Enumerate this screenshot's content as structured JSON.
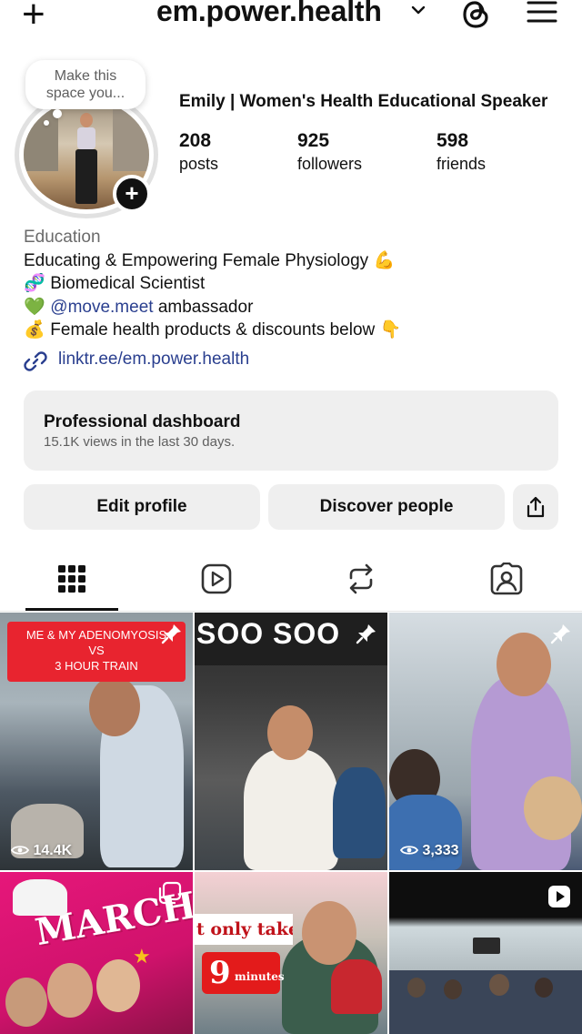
{
  "header": {
    "username": "em.power.health",
    "icons": [
      "plus-icon",
      "chevron-down-icon",
      "threads-icon",
      "menu-icon"
    ]
  },
  "profile": {
    "note_bubble": "Make this space you...",
    "display_name": "Emily | Women's Health Educational Speaker",
    "stats": [
      {
        "value": "208",
        "label": "posts"
      },
      {
        "value": "925",
        "label": "followers"
      },
      {
        "value": "598",
        "label": "friends"
      }
    ]
  },
  "bio": {
    "category": "Education",
    "line1": "Educating & Empowering Female Physiology",
    "line1_emoji": "💪",
    "line2_emoji": "🧬",
    "line2": "Biomedical Scientist",
    "line3_emoji": "💚",
    "line3_mention": "@move.meet",
    "line3_rest": " ambassador",
    "line4_emoji": "💰",
    "line4": "Female health products & discounts below",
    "line4_emoji_end": "👇",
    "link": "linktr.ee/em.power.health"
  },
  "dashboard": {
    "title": "Professional dashboard",
    "subtitle": "15.1K views in the last 30 days."
  },
  "buttons": {
    "edit_profile": "Edit profile",
    "discover_people": "Discover people"
  },
  "tabs": [
    "grid-icon",
    "reels-icon",
    "reposts-icon",
    "tagged-icon"
  ],
  "posts": [
    {
      "overlay_lines": [
        "ME & MY ADENOMYOSIS",
        "VS",
        "3 HOUR TRAIN"
      ],
      "views": "14.4K",
      "pinned": true
    },
    {
      "sign_text": "SOO SOO",
      "pinned": true
    },
    {
      "views": "3,333",
      "pinned": true
    },
    {
      "overlay_text": "MARCH"
    },
    {
      "overlay_text": "t only takes",
      "badge_number": "9",
      "badge_unit": "minutes"
    },
    {
      "type": "reel"
    }
  ]
}
